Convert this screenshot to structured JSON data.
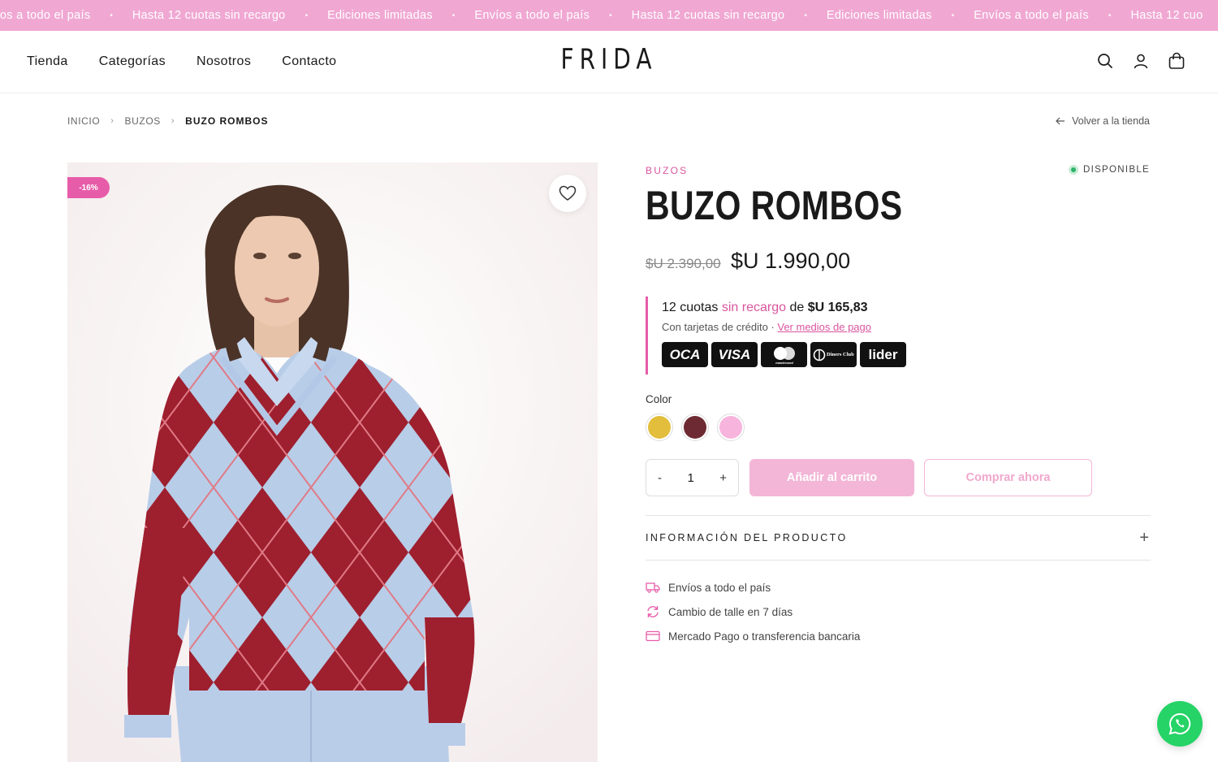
{
  "announcement": {
    "items": [
      "víos a todo el país",
      "Hasta 12 cuotas sin recargo",
      "Ediciones limitadas",
      "Envíos a todo el país",
      "Hasta 12 cuotas sin recargo",
      "Ediciones limitadas",
      "Envíos a todo el país",
      "Hasta 12 cuo"
    ],
    "separator": "•"
  },
  "nav": {
    "links": [
      "Tienda",
      "Categorías",
      "Nosotros",
      "Contacto"
    ]
  },
  "brand": {
    "logo": "FRIDA"
  },
  "header_icons": [
    "search-icon",
    "account-icon",
    "cart-icon"
  ],
  "breadcrumb": {
    "home": "INICIO",
    "category": "BUZOS",
    "current": "BUZO ROMBOS",
    "back": "Volver a la tienda"
  },
  "product": {
    "badge": "-16%",
    "category": "BUZOS",
    "stock": "DISPONIBLE",
    "title": "BUZO ROMBOS",
    "price_old": "$U 2.390,00",
    "price_new": "$U 1.990,00",
    "installments": {
      "count_text": "12 cuotas",
      "highlight": "sin recargo",
      "connector": "de",
      "amount": "$U 165,83",
      "sub_text": "Con tarjetas de crédito ·",
      "link": "Ver medios de pago",
      "cards": [
        "OCA",
        "VISA",
        "mastercard",
        "Diners Club",
        "lider"
      ]
    },
    "color_label": "Color",
    "colors": [
      {
        "name": "amarillo",
        "hex": "#e3be3c"
      },
      {
        "name": "bordo",
        "hex": "#6e2a32"
      },
      {
        "name": "rosa",
        "hex": "#f7b4dc"
      }
    ],
    "quantity": {
      "minus": "-",
      "value": "1",
      "plus": "+"
    },
    "add_to_cart": "Añadir al carrito",
    "buy_now": "Comprar ahora",
    "accordion_label": "INFORMACIÓN DEL PRODUCTO",
    "accordion_icon": "+",
    "perks": [
      "Envíos a todo el país",
      "Cambio de talle en 7 días",
      "Mercado Pago o transferencia bancaria"
    ]
  },
  "colors": {
    "accent": "#e75ca9",
    "announcement_bg": "#f0a8d3",
    "button_disabled": "#f3b6d6",
    "whatsapp": "#25d366",
    "stock_dot": "#2db36a"
  }
}
